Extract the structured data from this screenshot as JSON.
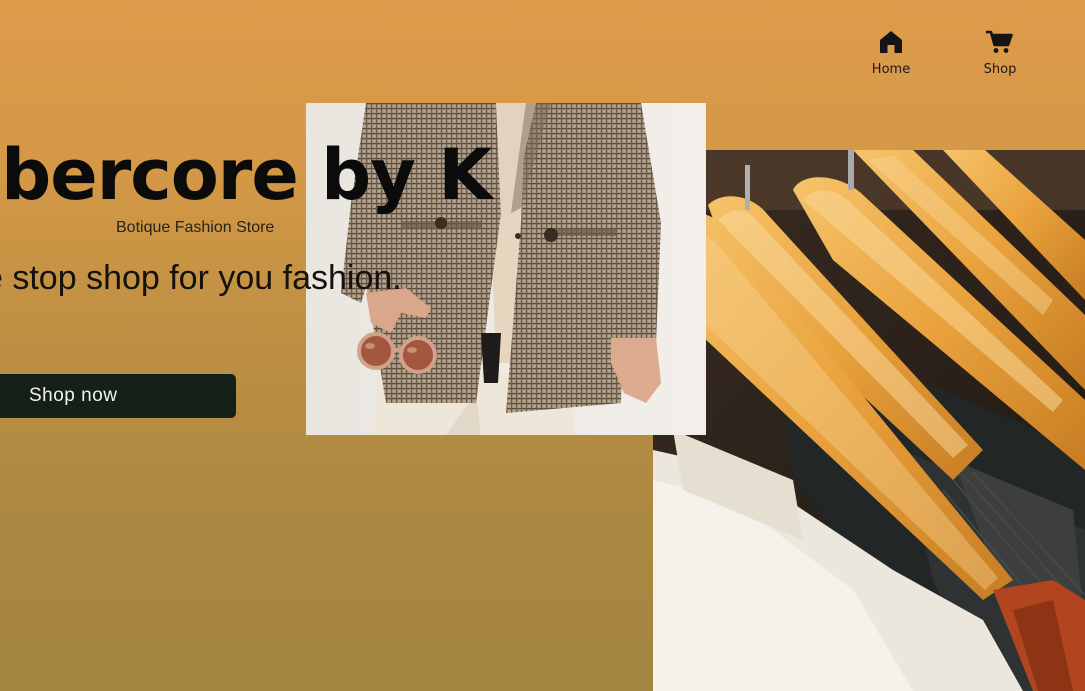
{
  "nav": {
    "items": [
      {
        "label": "Home",
        "icon": "home-icon"
      },
      {
        "label": "Shop",
        "icon": "cart-icon"
      }
    ]
  },
  "hero": {
    "title": "bbercore by K",
    "subtitle": "Botique Fashion Store",
    "tagline": "e stop shop for you fashion.",
    "cta_label": "Shop now"
  },
  "images": {
    "blazer_photo": "model-in-plaid-blazer-with-sunglasses",
    "hangers_photo": "clothes-on-wooden-hangers"
  },
  "colors": {
    "background_top": "#de9b4b",
    "background_bottom": "#a3853f",
    "button": "#152019",
    "button_text": "#f2f2f2"
  }
}
